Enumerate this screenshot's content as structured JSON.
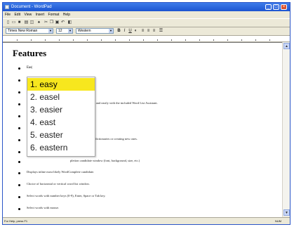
{
  "window": {
    "title": "Document - WordPad"
  },
  "menu": [
    "File",
    "Edit",
    "View",
    "Insert",
    "Format",
    "Help"
  ],
  "format_bar": {
    "font": "Times New Roman",
    "size": "12",
    "script": "Western"
  },
  "document": {
    "heading": "Features",
    "typed": "Eas|",
    "items": [
      "(word fragment behind popup) words)",
      "",
      "(partially hidden) dictionaries quickly and easily with the included Word List Assistant.",
      "(hidden) lt as you type.",
      "(hidden) lbl and phrases",
      "(hidden) modifying existing dictionaries or creating new ones.",
      "",
      "(hidden) pletion candidate window (font, background, size, etc.)",
      "Displays inline most likely WordComplete candidate.",
      "Choice of horizontal or vertical word list window.",
      "Select words with number keys (0-9), Enter, Space or Tab key.",
      "Select words with mouse.",
      "Automatic resizing based on how many words are predicted.",
      "Optional Transparent windows."
    ]
  },
  "suggestions": [
    {
      "num": "1.",
      "word": "easy",
      "selected": true
    },
    {
      "num": "2.",
      "word": "easel",
      "selected": false
    },
    {
      "num": "3.",
      "word": "easier",
      "selected": false
    },
    {
      "num": "4.",
      "word": "east",
      "selected": false
    },
    {
      "num": "5.",
      "word": "easter",
      "selected": false
    },
    {
      "num": "6.",
      "word": "eastern",
      "selected": false
    }
  ],
  "status": {
    "help": "For Help, press F1",
    "mode": "NUM"
  },
  "colors": {
    "selection": "#f7e71e",
    "titlebar": "#1c54d0"
  }
}
